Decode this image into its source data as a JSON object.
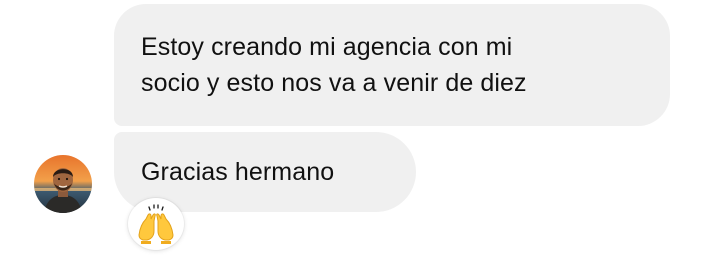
{
  "conversation": {
    "messages": [
      {
        "sender": "self",
        "lines": [
          "Estoy creando mi agencia con mi",
          "socio y esto nos va a venir de diez"
        ]
      },
      {
        "sender": "contact",
        "text": "Gracias hermano",
        "reaction": {
          "icon": "raising-hands-icon"
        }
      }
    ],
    "avatar": {
      "icon": "contact-avatar"
    }
  },
  "colors": {
    "bubble_background": "#f0f0f0",
    "text": "#111111",
    "page_background": "#ffffff"
  }
}
